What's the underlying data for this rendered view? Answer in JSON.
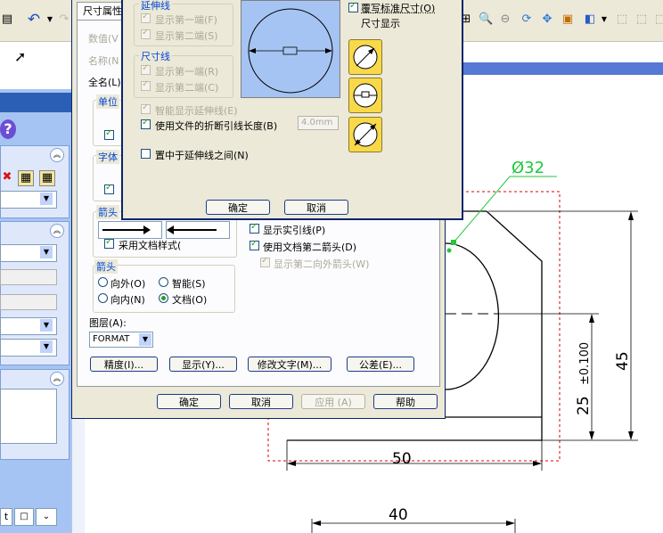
{
  "toolbar": {
    "tab_fragment": "尺寸属性"
  },
  "outer_dialog": {
    "tab_label": "尺寸属性",
    "value_label": "数值(V",
    "name_label": "名称(N",
    "fullname_label": "全名(L)",
    "unit_group": "单位",
    "font_group": "字体",
    "arrow_group_top": "箭头",
    "use_doc_style": "采用文档样式(",
    "arrow_group": "箭头",
    "arrow_out": "向外(O)",
    "arrow_smart": "智能(S)",
    "arrow_in": "向内(N)",
    "arrow_doc": "文档(O)",
    "show_leader": "显示实引线(P)",
    "use_second_arrow": "使用文档第二箭头(D)",
    "show_second_outer_arrow": "显示第二向外箭头(W)",
    "layer_label": "图层(A):",
    "layer_value": "FORMAT",
    "precision_btn": "精度(I)...",
    "display_btn": "显示(Y)...",
    "modify_text_btn": "修改文字(M)...",
    "tolerance_btn": "公差(E)...",
    "ok": "确定",
    "cancel": "取消",
    "apply": "应用 (A)",
    "help": "帮助"
  },
  "inner_dialog": {
    "ext_line_group": "延伸线",
    "show_first_end_ext": "显示第一端(F)",
    "show_second_end_ext": "显示第二端(S)",
    "dim_line_group": "尺寸线",
    "show_first_end_dim": "显示第一端(R)",
    "show_second_end_dim": "显示第二端(C)",
    "smart_ext": "智能显示延伸线(E)",
    "use_break_len": "使用文件的折断引线长度(B)",
    "break_len_value": "4.0mm",
    "center_between": "置中于延伸线之间(N)",
    "override_std": "覆写标准尺寸(O)",
    "dim_display": "尺寸显示",
    "ok": "确定",
    "cancel": "取消"
  },
  "drawing": {
    "dia_label": "Ø32",
    "dim_45": "45",
    "dim_25": "25",
    "dim_tol": "±0.100",
    "dim_50": "50",
    "dim_40": "40"
  },
  "colors": {
    "accent": "#0a246a",
    "dialog_face": "#ece9d8",
    "panel_blue": "#a6c4f3",
    "dim_green": "#22c83a",
    "boundary_red": "#e00000"
  }
}
